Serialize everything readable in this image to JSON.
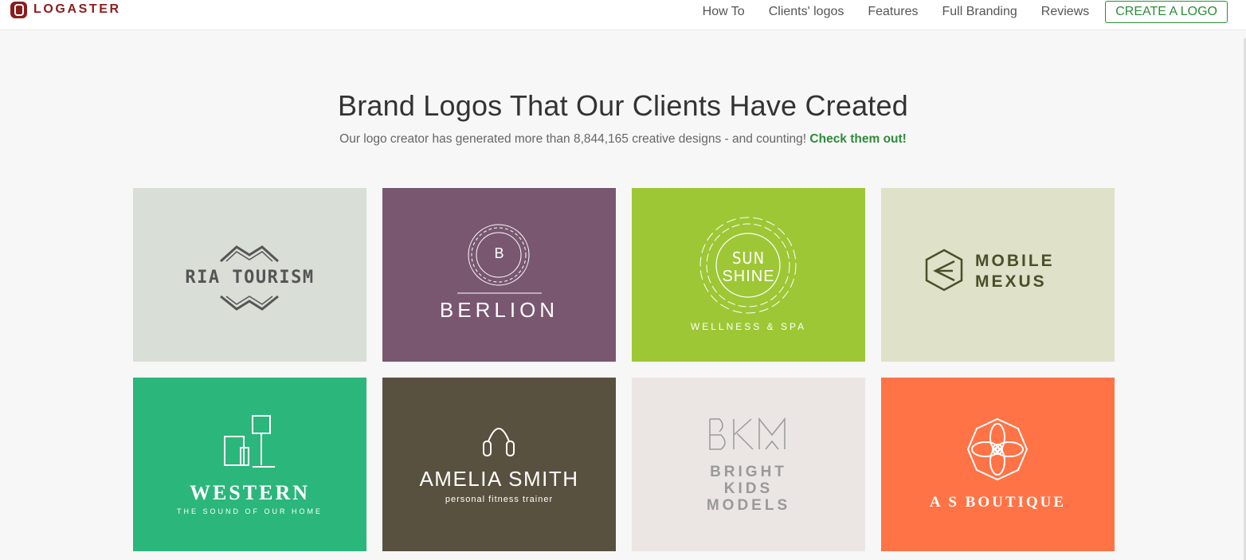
{
  "brand": {
    "name": "LOGASTER",
    "icon": "logaster-logo-icon",
    "color": "#8b1c1c"
  },
  "nav": {
    "items": [
      "How To",
      "Clients' logos",
      "Features",
      "Full Branding",
      "Reviews"
    ],
    "cta": "CREATE A LOGO"
  },
  "hero": {
    "title": "Brand Logos That Our Clients Have Created",
    "subtitle": "Our logo creator has generated more than 8,844,165 creative designs - and counting!",
    "link": "Check them out!"
  },
  "tiles": [
    {
      "name": "RIA TOURISM",
      "bg": "#d9ded6",
      "icon": "mountain-chevron-icon"
    },
    {
      "monogram": "B",
      "name": "BERLION",
      "bg": "#795770",
      "icon": "ornament-wreath-icon"
    },
    {
      "line1": "SUN",
      "line2": "SHINE",
      "tagline": "WELLNESS & SPA",
      "bg": "#9dc735",
      "icon": "sun-flower-icon"
    },
    {
      "line1": "MOBILE",
      "line2": "MEXUS",
      "bg": "#dfe2c8",
      "icon": "hexagon-e-icon"
    },
    {
      "name": "WESTERN",
      "tagline": "THE SOUND OF OUR HOME",
      "bg": "#2bb67b",
      "icon": "lamp-armchair-icon"
    },
    {
      "name": "AMELIA SMITH",
      "tagline": "personal fitness trainer",
      "bg": "#59513f",
      "icon": "jump-rope-icon"
    },
    {
      "monogram": "BKM",
      "line1": "BRIGHT",
      "line2": "KIDS",
      "line3": "MODELS",
      "bg": "#ebe6e4",
      "icon": "bkm-lines-icon"
    },
    {
      "name": "A S  BOUTIQUE",
      "bg": "#ff7346",
      "icon": "mandala-flower-icon"
    }
  ],
  "colors": {
    "accent_green": "#2e8b3a"
  }
}
